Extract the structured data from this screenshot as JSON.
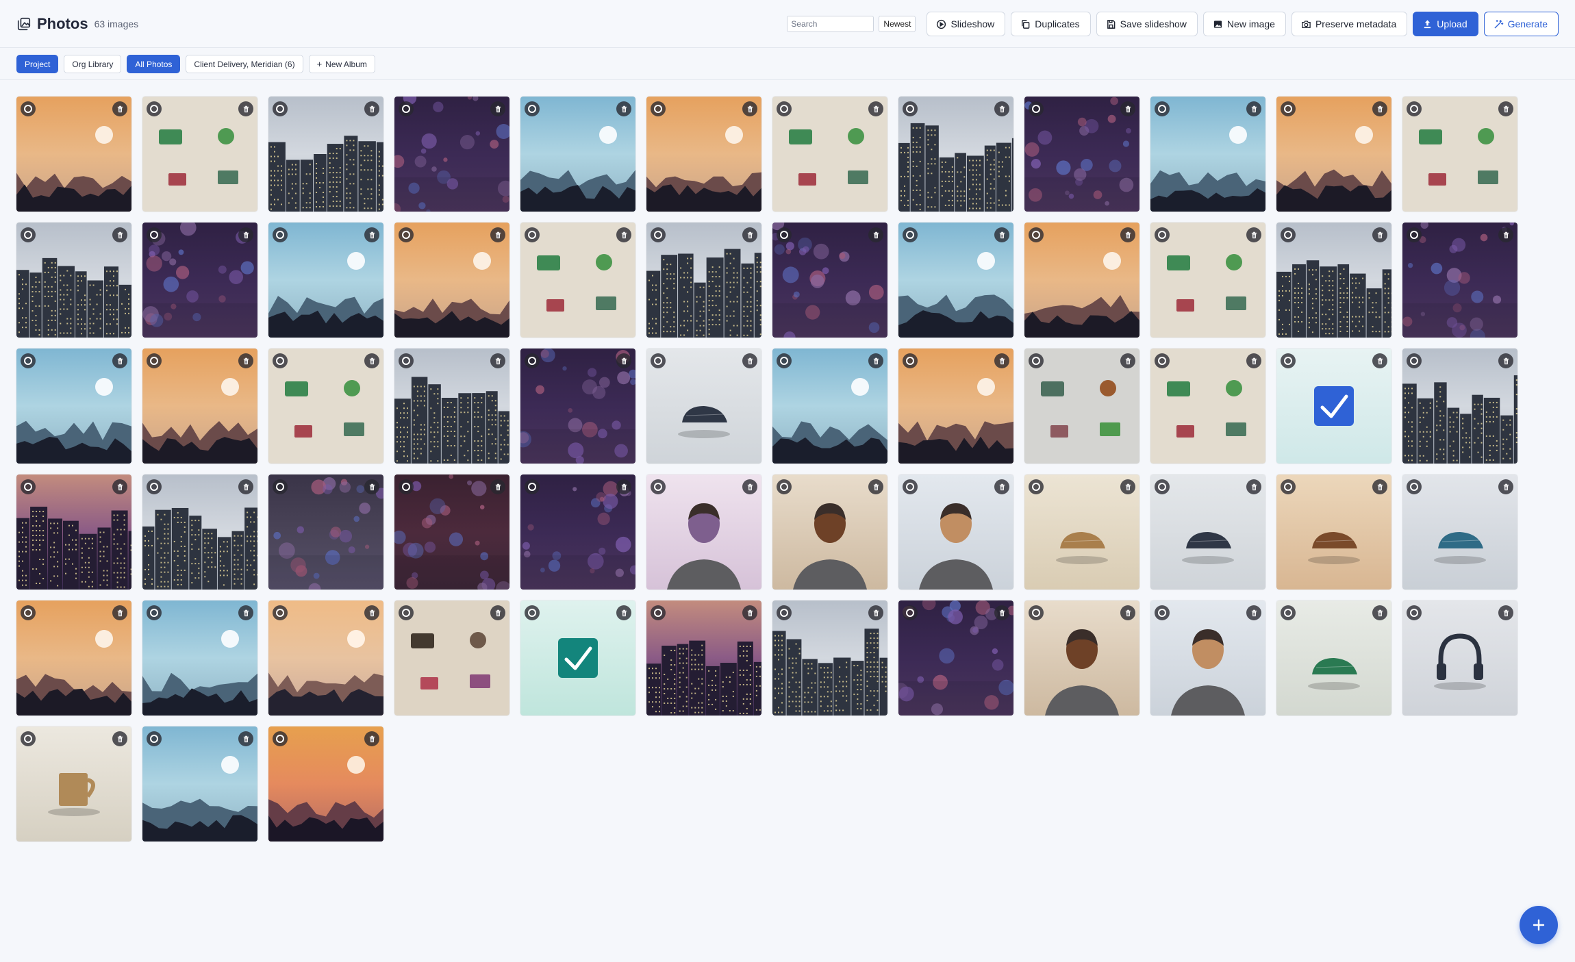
{
  "header": {
    "title": "Photos",
    "count": "63 images",
    "search_placeholder": "Search",
    "sort": "Newest",
    "buttons": {
      "slideshow": "Slideshow",
      "duplicates": "Duplicates",
      "save_slideshow": "Save slideshow",
      "new_image": "New image",
      "preserve_metadata": "Preserve metadata",
      "upload": "Upload",
      "generate": "Generate"
    }
  },
  "albums": {
    "project": "Project",
    "org_library": "Org Library",
    "all_photos": "All Photos",
    "client": "Client Delivery, Meridian (6)",
    "new_album": "New Album"
  },
  "accent_color": "#2f62d6",
  "photos": [
    "sunset",
    "desk",
    "city",
    "bokeh",
    "lake",
    "sunset",
    "desk",
    "city",
    "bokeh",
    "lake",
    "sunset",
    "desk",
    "city",
    "bokeh",
    "lake",
    "sunset",
    "desk",
    "city",
    "bokeh",
    "lake",
    "sunset",
    "desk",
    "city",
    "bokeh",
    "lake",
    "sunset",
    "desk",
    "city",
    "bokeh",
    "shoe-dark",
    "lake",
    "sunset",
    "desk-grey",
    "desk",
    "check-blue",
    "city",
    "city-dusk",
    "city",
    "bokeh-grey",
    "bokeh-red",
    "bokeh",
    "portrait-purple",
    "portrait-brown",
    "portrait-tan",
    "shoe-tan",
    "shoe-dark",
    "shoe-brown",
    "shoe-teal",
    "sunset",
    "lake",
    "sunset-light",
    "desk-dark",
    "check-teal",
    "city-dusk",
    "city",
    "bokeh",
    "portrait-brown",
    "portrait-tan",
    "shoe-green",
    "headphones",
    "mug",
    "lake",
    "sunset-orange"
  ]
}
